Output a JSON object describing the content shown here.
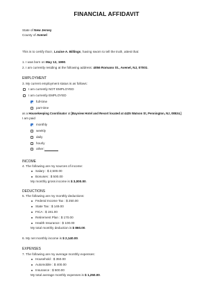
{
  "title": "FINANCIAL AFFIDAVIT",
  "state_label": "State of",
  "state_value": "New Jersey",
  "county_label": "County of",
  "county_value": "Avenel",
  "certify_prefix": "This is to certify that I,",
  "certify_name": "Louise A. Billings",
  "certify_suffix": ", having sworn to tell the truth, attest that:",
  "item1_prefix": "1. I was born on",
  "item1_value": "May 12, 1990",
  "item2_prefix": "2. I am currently residing at the following address:",
  "item2_value": "4056 Romano St., Avenel, NJ, 07001",
  "employment": {
    "heading": "EMPLOYMENT",
    "intro": "3. My current employment status is as follows:",
    "not_employed": "I am currently NOT EMPLOYED",
    "employed": "I am currently EMPLOYED",
    "full_time": "full-time",
    "part_time": "part-time",
    "as_a_prefix": "as a",
    "role": "Housekeeping Coordinator",
    "at": "at",
    "employer": "[Bayview Hotel and Resort located at 4425 Watson St, Pennington, NJ, 08534.]",
    "paid_label": "I am paid",
    "pay_options": [
      "monthly",
      "weekly",
      "daily",
      "hourly",
      "other:"
    ],
    "pay_checked": [
      true,
      false,
      false,
      false,
      false
    ],
    "not_employed_checked": false,
    "employed_checked": false,
    "full_time_checked": true,
    "part_time_checked": false
  },
  "income": {
    "heading": "INCOME",
    "intro": "4. The following are my sources of income:",
    "items": [
      "Salary : $ 2,500.00",
      "Bonuses : $ 500.00"
    ],
    "total_prefix": "My monthly gross income is",
    "total_value": "$ 3,000.00"
  },
  "deductions": {
    "heading": "DEDUCTIONS",
    "intro": "5. The following are my monthly deductions:",
    "items": [
      "Federal Income Tax : $ 250.00",
      "State Tax : $ 149.00",
      "FICA : $ 191.00",
      "Retirement Plan : $ 170.00",
      "Health Insurance : $ 100.00"
    ],
    "total_prefix": "My total monthly deduction is",
    "total_value": "$ 860.00"
  },
  "net_prefix": "6. My net monthly income is",
  "net_value": "$ 2,140.00",
  "expenses": {
    "heading": "EXPENSES",
    "intro": "7. The following are my average monthly expenses:",
    "items": [
      "Household : $ 350.00",
      "Automobile : $ 400.00",
      "Insurance : $ 500.00"
    ],
    "total_prefix": "My total average monthly expenses is",
    "total_value": "$ 1,250.00"
  }
}
